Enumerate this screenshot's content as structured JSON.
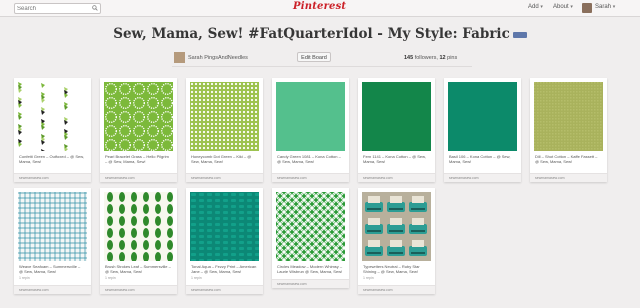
{
  "search": {
    "placeholder": "Search"
  },
  "logo": "Pinterest",
  "nav": {
    "add": "Add",
    "about": "About",
    "user": "Sarah"
  },
  "board": {
    "title": "Sew, Mama, Sew! #FatQuarterIdol - My Style: Fabric",
    "owner": "Sarah PingsAndNeedles",
    "edit_label": "Edit Board",
    "followers_count": "145",
    "followers_label": "followers,",
    "pins_count": "12",
    "pins_label": "pins"
  },
  "colors": {
    "brand": "#cb2027",
    "background": "#f0eeee"
  },
  "pins": [
    {
      "desc": "Confetti Green – Outfoxed – @ Sew, Mama, Sew!",
      "meta": "",
      "source": "sewmamasew.com",
      "pattern": "confetti"
    },
    {
      "desc": "Pearl Bracelet Grass – Hello Pilgrim – @ Sew, Mama, Sew!",
      "meta": "",
      "source": "sewmamasew.com",
      "pattern": "pearl"
    },
    {
      "desc": "Honeycomb Dot Green – Kiki – @ Sew, Mama, Sew!",
      "meta": "",
      "source": "sewmamasew.com",
      "pattern": "honeycomb"
    },
    {
      "desc": "Candy Green 1081 – Kona Cotton – @ Sew, Mama, Sew!",
      "meta": "",
      "source": "sewmamasew.com",
      "pattern": "solid-mint"
    },
    {
      "desc": "Fern 1141 – Kona Cotton – @ Sew, Mama, Sew!",
      "meta": "",
      "source": "sewmamasew.com",
      "pattern": "solid-green"
    },
    {
      "desc": "Basil 106 – Kona Cotton – @ Sew, Mama, Sew!",
      "meta": "",
      "source": "sewmamasew.com",
      "pattern": "solid-teal"
    },
    {
      "desc": "Dill – Shot Cotton – Kaffe Fassett – @ Sew, Mama, Sew!",
      "meta": "",
      "source": "sewmamasew.com",
      "pattern": "shot"
    },
    {
      "desc": "Weave Seafoam – Summersville – @ Sew, Mama, Sew!",
      "meta": "1 repin",
      "source": "sewmamasew.com",
      "pattern": "weave"
    },
    {
      "desc": "Brush Strokes Leaf – Summersville – @ Sew, Mama, Sew!",
      "meta": "1 repin",
      "source": "sewmamasew.com",
      "pattern": "strokes"
    },
    {
      "desc": "Tonal Aqua – Fezzy Print – American Jane – @ Sew, Mama, Sew!",
      "meta": "1 repin",
      "source": "sewmamasew.com",
      "pattern": "tonal"
    },
    {
      "desc": "Circles Meadow – Modern Whimsy – Laurie Wisbrun @ Sew, Mama, Sew!",
      "meta": "",
      "source": "sewmamasew.com",
      "pattern": "circles"
    },
    {
      "desc": "Typewriters Neutral – Ruby Star Shining – @ Sew, Mama, Sew!",
      "meta": "1 repin",
      "source": "sewmamasew.com",
      "pattern": "typewriter"
    }
  ]
}
